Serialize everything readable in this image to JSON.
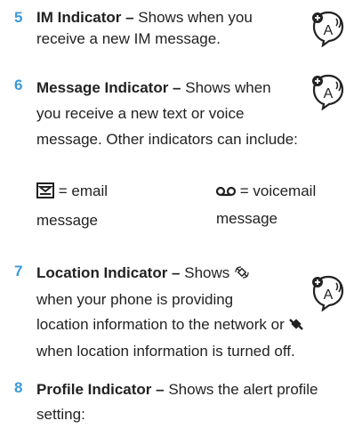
{
  "items": [
    {
      "number": "5",
      "title": "IM Indicator –",
      "lines": [
        " Shows when you",
        "receive a new IM message."
      ],
      "icon": "feature-speech-icon"
    },
    {
      "number": "6",
      "title": "Message Indicator –",
      "lines": [
        " Shows when",
        "you receive a new text or voice",
        "message. Other indicators can include:"
      ],
      "icon": "feature-speech-icon"
    },
    {
      "number": "7",
      "title": "Location Indicator –",
      "lines": [
        " Shows ",
        "when your phone is providing",
        "location information to the network or ",
        "when location information is turned off."
      ],
      "icon": "feature-speech-icon"
    },
    {
      "number": "8",
      "title": "Profile Indicator –",
      "lines": [
        " Shows the alert profile",
        "setting:"
      ]
    }
  ],
  "message_types": {
    "email": {
      "symbol": "email-icon",
      "line1": " = email",
      "line2": "message"
    },
    "voicemail": {
      "symbol": "voicemail-icon",
      "line1": " = voicemail",
      "line2": "message"
    }
  },
  "colors": {
    "number": "#3a9ad9",
    "text": "#222222"
  }
}
